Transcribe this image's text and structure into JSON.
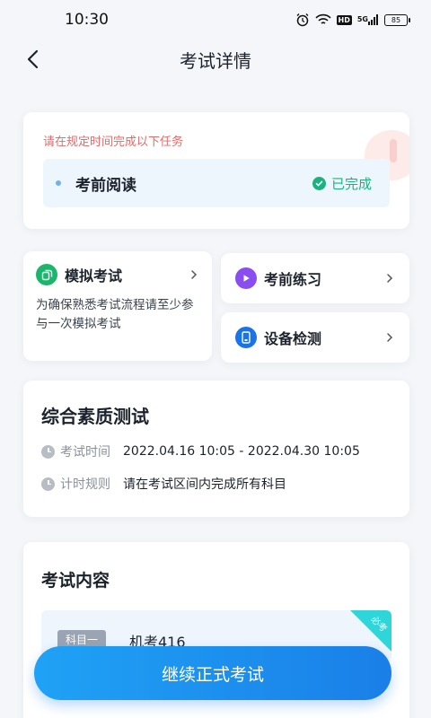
{
  "status_bar": {
    "time": "10:30",
    "signal_label": "5G",
    "hd_label": "HD",
    "battery": "85"
  },
  "header": {
    "title": "考试详情"
  },
  "task_card": {
    "notice": "请在规定时间完成以下任务",
    "item_name": "考前阅读",
    "item_status": "已完成"
  },
  "features": {
    "mock_exam": {
      "title": "模拟考试",
      "desc": "为确保熟悉考试流程请至少参与一次模拟考试"
    },
    "practice": {
      "title": "考前练习"
    },
    "device_check": {
      "title": "设备检测"
    }
  },
  "quality_test": {
    "title": "综合素质测试",
    "time_label": "考试时间",
    "time_value": "2022.04.16 10:05 - 2022.04.30 10:05",
    "rule_label": "计时规则",
    "rule_value": "请在考试区间内完成所有科目"
  },
  "exam_content": {
    "title": "考试内容",
    "subject_tag": "科目一",
    "subject_name": "机考416",
    "required_badge": "必考"
  },
  "actions": {
    "continue_label": "继续正式考试"
  },
  "colors": {
    "primary": "#1a7fe8",
    "success": "#17b47e",
    "warning_text": "#e36a6a",
    "mock_icon": "#1bb56b",
    "practice_icon": "#8a4df0",
    "device_icon": "#1a73e8"
  }
}
